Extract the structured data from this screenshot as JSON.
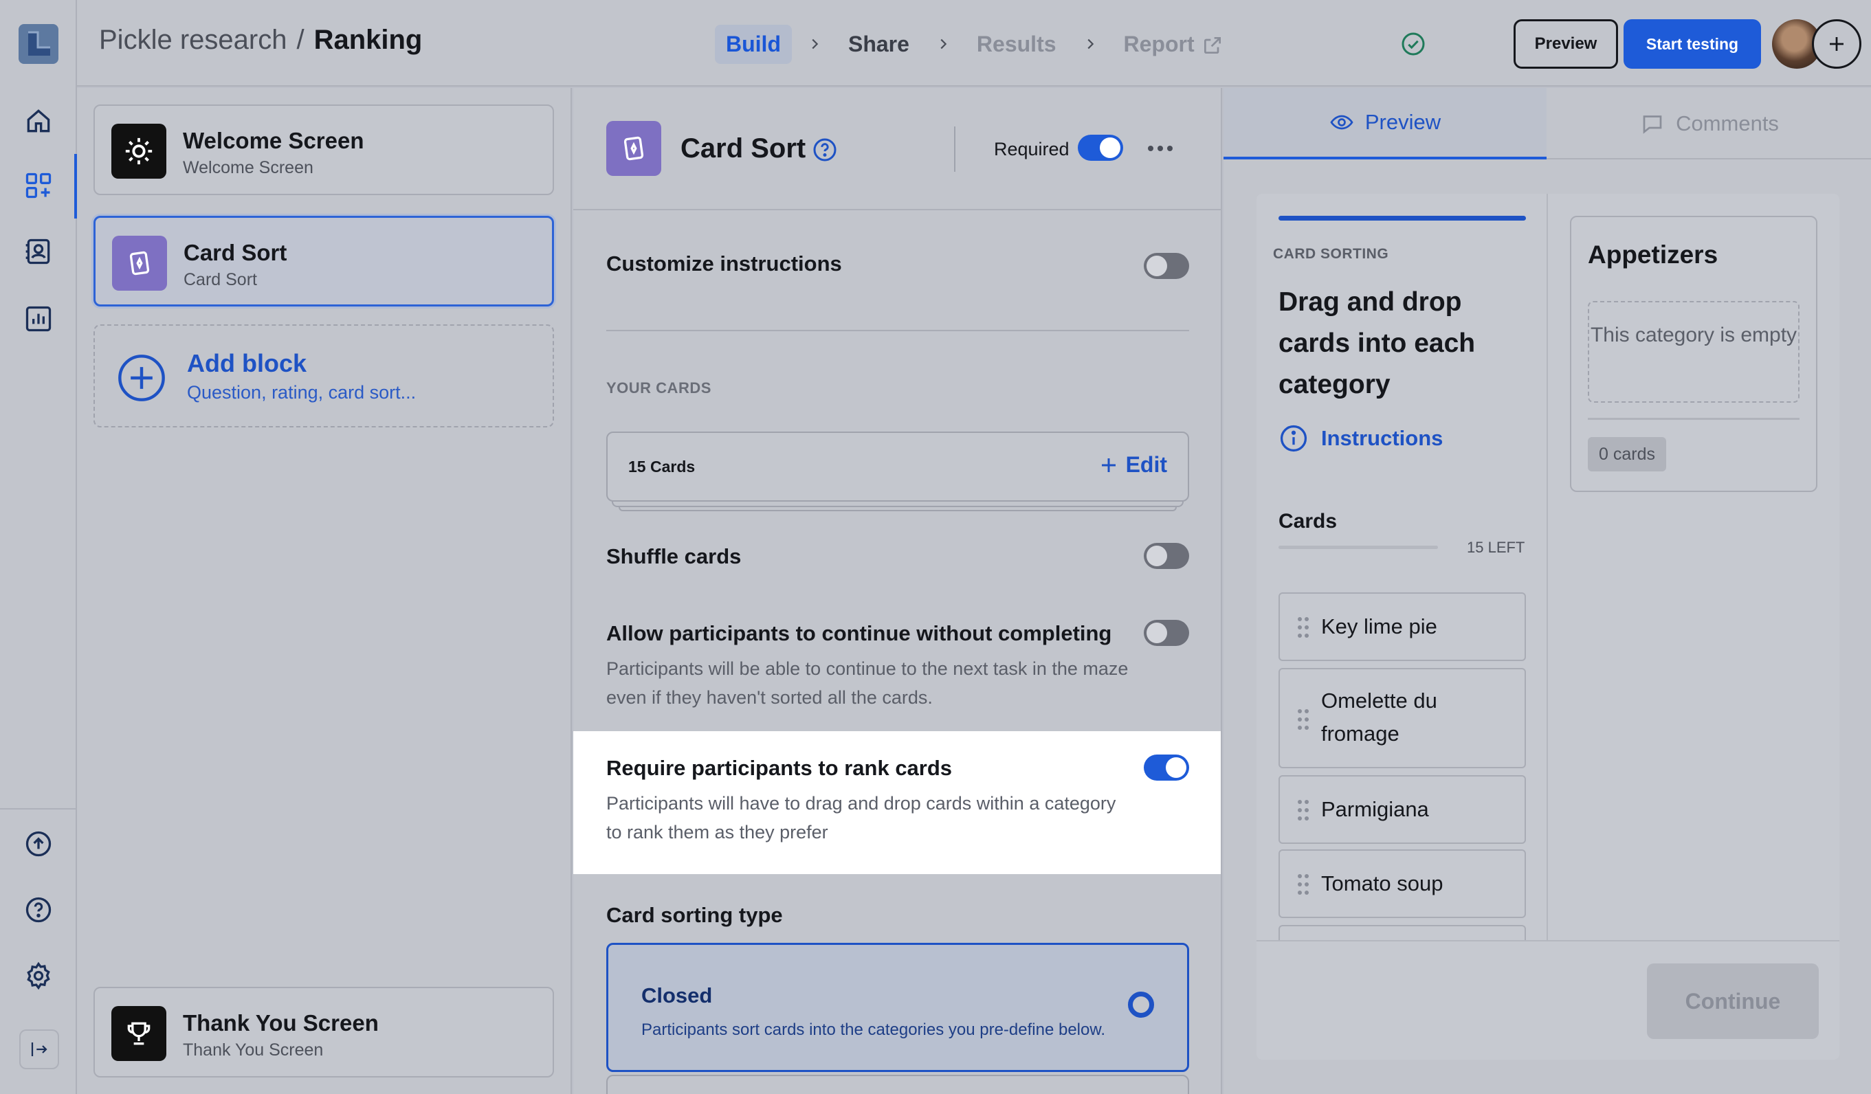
{
  "header": {
    "project": "Pickle research",
    "separator": "/",
    "maze": "Ranking",
    "steps": [
      {
        "label": "Build"
      },
      {
        "label": "Share"
      },
      {
        "label": "Results"
      },
      {
        "label": "Report"
      }
    ],
    "preview_label": "Preview",
    "start_label": "Start testing"
  },
  "blocks": {
    "items": [
      {
        "title": "Welcome Screen",
        "subtitle": "Welcome Screen"
      },
      {
        "title": "Card Sort",
        "subtitle": "Card Sort"
      }
    ],
    "add_title": "Add block",
    "add_subtitle": "Question, rating, card sort...",
    "thanks_title": "Thank You Screen",
    "thanks_subtitle": "Thank You Screen"
  },
  "settings": {
    "title": "Card Sort",
    "required_label": "Required",
    "customize_label": "Customize instructions",
    "your_cards_label": "YOUR CARDS",
    "cards_count": "15 Cards",
    "edit_label": "Edit",
    "shuffle_label": "Shuffle cards",
    "allow_title": "Allow participants to continue without completing",
    "allow_desc": "Participants will be able to continue to the next task in the maze even if they haven't sorted all the cards.",
    "rank_title": "Require participants to rank cards",
    "rank_desc": "Participants will have to drag and drop cards within a category to rank them as they prefer",
    "sorting_type_label": "Card sorting type",
    "closed_title": "Closed",
    "closed_desc": "Participants sort cards into the categories you pre-define below."
  },
  "preview": {
    "tab_preview": "Preview",
    "tab_comments": "Comments",
    "section_label": "CARD SORTING",
    "heading": "Drag and drop cards into each category",
    "instructions_label": "Instructions",
    "cards_title": "Cards",
    "cards_left": "15 LEFT",
    "cards": [
      "Key lime pie",
      "Omelette du fromage",
      "Parmigiana",
      "Tomato soup"
    ],
    "category_title": "Appetizers",
    "category_empty": "This category is empty",
    "category_count": "0 cards",
    "continue_label": "Continue"
  },
  "colors": {
    "accent": "#1e5bd8",
    "block_icon_purple": "#7e70c2"
  }
}
